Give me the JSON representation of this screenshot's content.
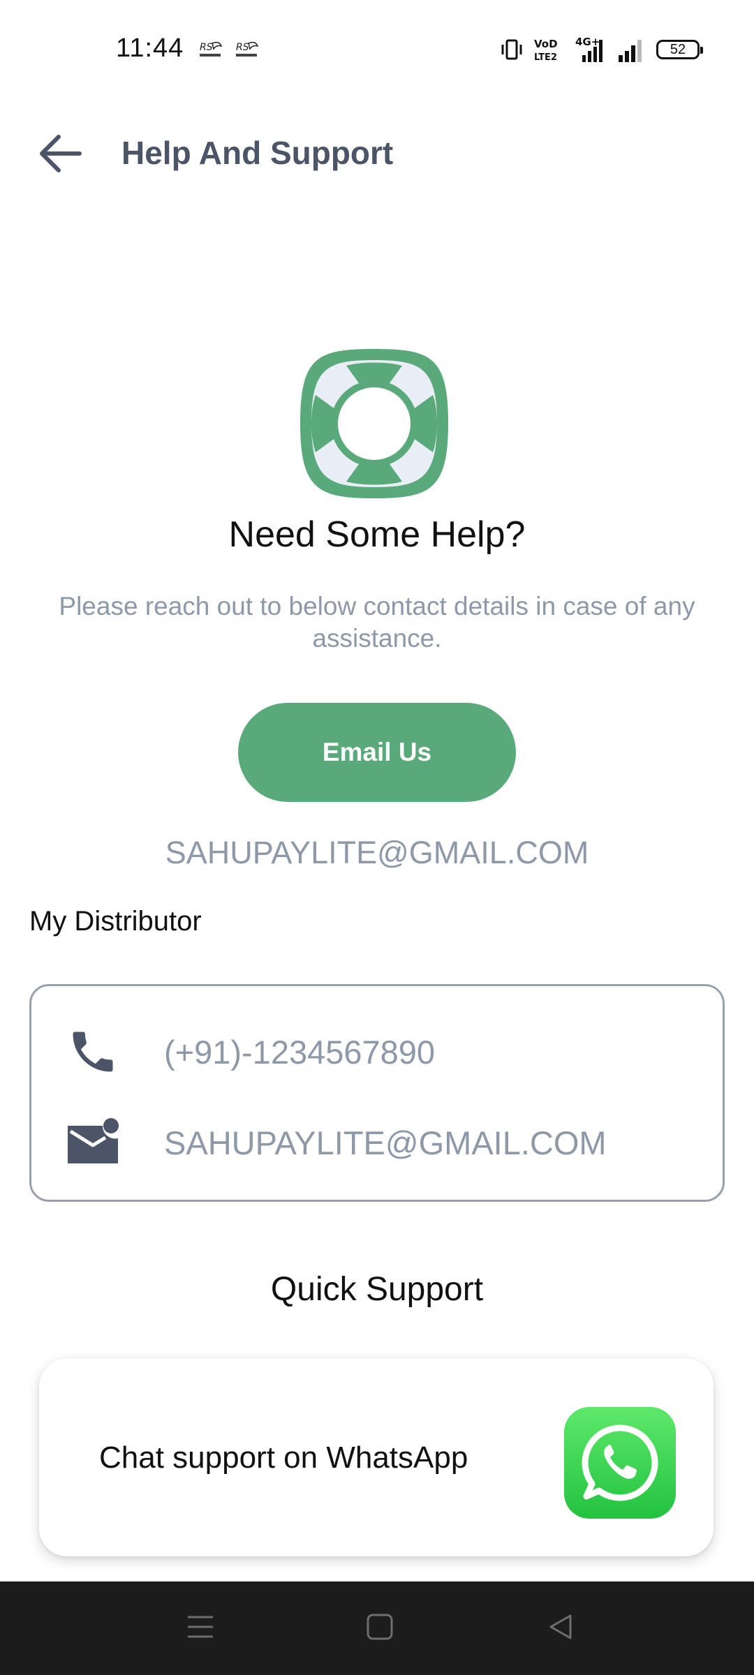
{
  "status_bar": {
    "time": "11:44",
    "battery": "52",
    "network": "4G+"
  },
  "app_bar": {
    "title": "Help And Support"
  },
  "hero": {
    "title": "Need Some Help?",
    "description": "Please reach out to below contact details in case of any assistance.",
    "email_button_label": "Email Us",
    "support_email": "SAHUPAYLITE@GMAIL.COM"
  },
  "distributor": {
    "heading": "My Distributor",
    "phone": "(+91)-1234567890",
    "email": "SAHUPAYLITE@GMAIL.COM"
  },
  "quick_support": {
    "title": "Quick Support",
    "whatsapp_label": "Chat support on WhatsApp"
  },
  "colors": {
    "primary_green": "#5aa97b",
    "title_gray": "#4b5567",
    "muted_text": "#8d98a8",
    "whatsapp_green": "#25d366"
  },
  "icons": {
    "back": "arrow-left-icon",
    "hero": "lifebuoy-icon",
    "phone": "phone-icon",
    "mail": "mail-notification-icon",
    "whatsapp": "whatsapp-icon"
  }
}
